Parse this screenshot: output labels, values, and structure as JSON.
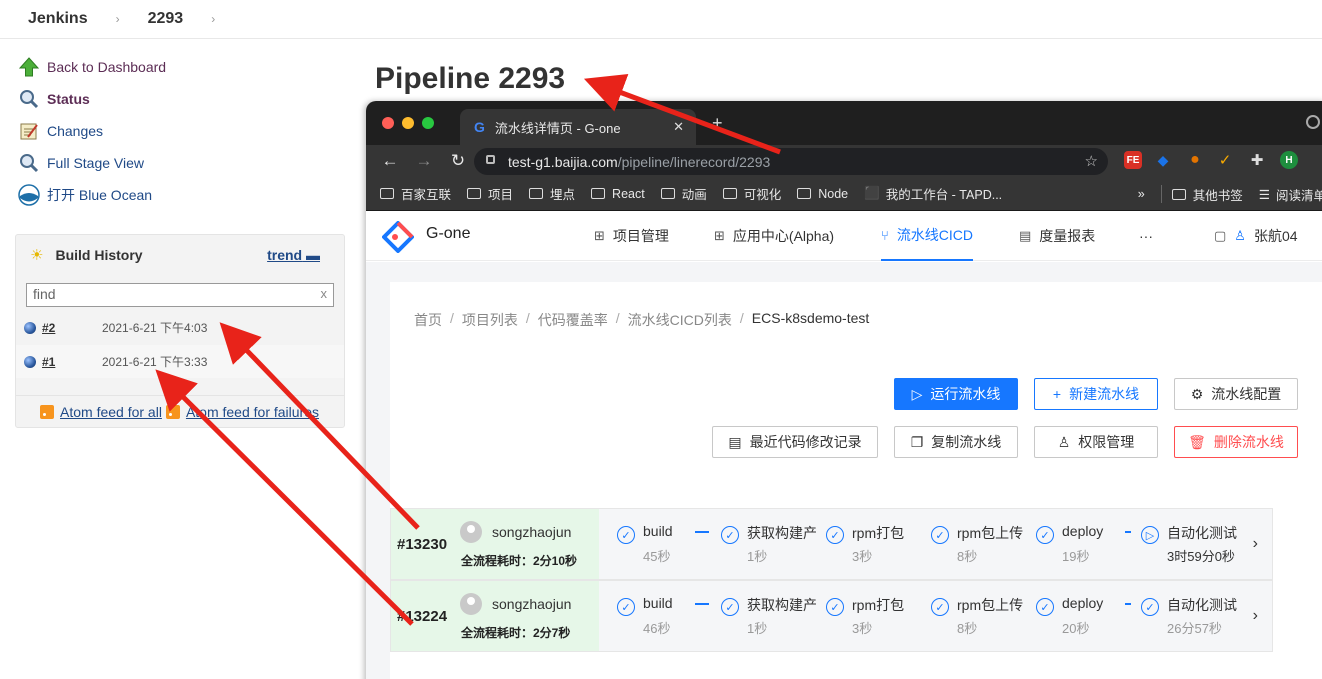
{
  "jenkins": {
    "breadcrumb": [
      "Jenkins",
      "2293"
    ],
    "sidebar": [
      {
        "label": "Back to Dashboard",
        "icon": "up-arrow-icon"
      },
      {
        "label": "Status",
        "icon": "magnifier-icon"
      },
      {
        "label": "Changes",
        "icon": "notepad-icon"
      },
      {
        "label": "Full Stage View",
        "icon": "magnifier-icon"
      },
      {
        "label": "打开 Blue Ocean",
        "icon": "blue-ocean-icon"
      }
    ],
    "build_history": {
      "title": "Build History",
      "trend": "trend",
      "find_placeholder": "find",
      "clear": "x",
      "builds": [
        {
          "num": "#2",
          "date": "2021-6-21 下午4:03"
        },
        {
          "num": "#1",
          "date": "2021-6-21 下午3:33"
        }
      ],
      "feed_all": "Atom feed for all",
      "feed_failures": "Atom feed for failures"
    },
    "page_title": "Pipeline 2293"
  },
  "browser": {
    "tab_title": "流水线详情页 - G-one",
    "tab_close": "✕",
    "new_tab": "+",
    "url_host": "test-g1.baijia.com",
    "url_path": "/pipeline/linerecord/2293",
    "bookmarks": [
      "百家互联",
      "项目",
      "埋点",
      "React",
      "动画",
      "可视化",
      "Node",
      "我的工作台 - TAPD..."
    ],
    "bookmarks_more": "»",
    "bookmarks_right": [
      "其他书签",
      "阅读清单"
    ],
    "extensions": [
      {
        "label": "FE",
        "color": "#d93025"
      },
      {
        "label": "◆",
        "color": "#1a73e8"
      },
      {
        "label": "●",
        "color": "#e37400"
      },
      {
        "label": "✓",
        "color": "#f9ab00"
      },
      {
        "label": "✚",
        "color": "#5f6368"
      },
      {
        "label": "H",
        "color": "#1e8e3e"
      }
    ]
  },
  "app": {
    "brand": "G-one",
    "menu": [
      "项目管理",
      "应用中心(Alpha)",
      "流水线CICD",
      "度量报表",
      "···"
    ],
    "user": "张航04",
    "breadcrumbs": [
      "首页",
      "项目列表",
      "代码覆盖率",
      "流水线CICD列表",
      "ECS-k8sdemo-test"
    ],
    "buttons": {
      "run": "运行流水线",
      "new": "新建流水线",
      "config": "流水线配置",
      "history": "最近代码修改记录",
      "copy": "复制流水线",
      "permission": "权限管理",
      "delete": "删除流水线"
    },
    "runs": [
      {
        "id": "#13230",
        "user": "songzhaojun",
        "total": "全流程耗时：2分10秒",
        "stages": [
          {
            "name": "build",
            "time": "45秒"
          },
          {
            "name": "获取构建产",
            "time": "1秒"
          },
          {
            "name": "rpm打包",
            "time": "3秒"
          },
          {
            "name": "rpm包上传",
            "time": "8秒"
          },
          {
            "name": "deploy",
            "time": "19秒"
          },
          {
            "name": "自动化测试",
            "time": "3时59分0秒"
          }
        ]
      },
      {
        "id": "#13224",
        "user": "songzhaojun",
        "total": "全流程耗时：2分7秒",
        "stages": [
          {
            "name": "build",
            "time": "46秒"
          },
          {
            "name": "获取构建产",
            "time": "1秒"
          },
          {
            "name": "rpm打包",
            "time": "3秒"
          },
          {
            "name": "rpm包上传",
            "time": "8秒"
          },
          {
            "name": "deploy",
            "time": "20秒"
          },
          {
            "name": "自动化测试",
            "time": "26分57秒"
          }
        ]
      }
    ]
  },
  "colors": {
    "accent": "#1677ff",
    "danger": "#ff4d4f",
    "arrow": "#e8231a",
    "run_head": "#e6f7e8"
  }
}
